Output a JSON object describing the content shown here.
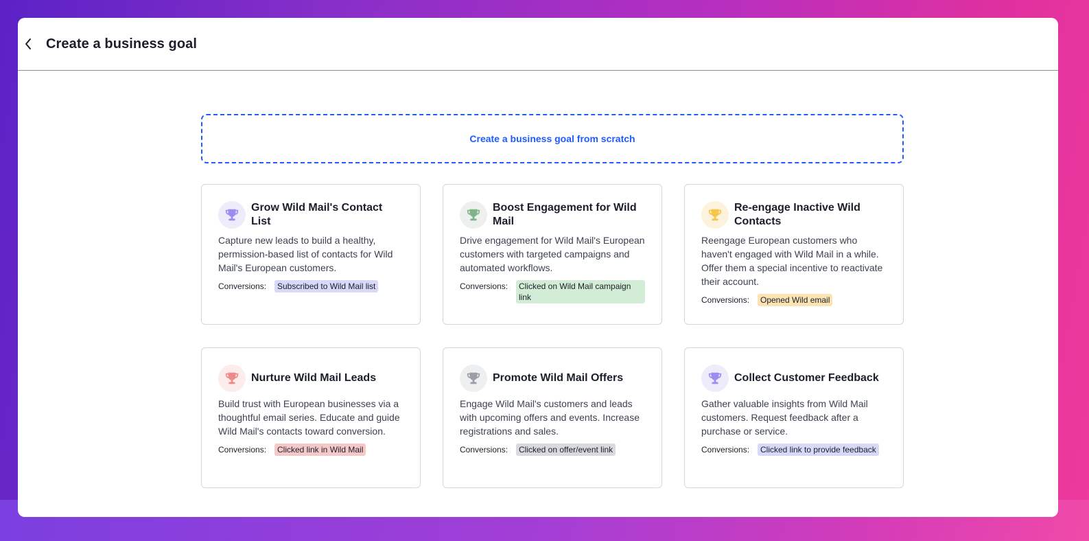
{
  "header": {
    "title": "Create a business goal"
  },
  "scratch": {
    "label": "Create a business goal from scratch"
  },
  "conversions_label": "Conversions:",
  "cards": [
    {
      "title": "Grow Wild Mail's Contact List",
      "description": "Capture new leads to build a healthy, permission-based list of contacts for Wild Mail's European customers.",
      "conversion": "Subscribed to Wild Mail list",
      "icon": "trophy-icon",
      "icon_color": "#9b8cf0",
      "icon_bg": "#eeecfb",
      "tag_color": "#d8d9f7"
    },
    {
      "title": "Boost Engagement for Wild Mail",
      "description": "Drive engagement for Wild Mail's European customers with targeted campaigns and automated workflows.",
      "conversion": "Clicked on Wild Mail campaign link",
      "icon": "trophy-icon",
      "icon_color": "#7fb38a",
      "icon_bg": "#edf0ed",
      "tag_color": "#d3ecd6"
    },
    {
      "title": "Re-engage Inactive Wild Contacts",
      "description": "Reengage European customers who haven't engaged with Wild Mail in a while. Offer them a special incentive to reactivate their account.",
      "conversion": "Opened Wild email",
      "icon": "trophy-icon",
      "icon_color": "#f5c64a",
      "icon_bg": "#fdf3dc",
      "tag_color": "#fbe3b4"
    },
    {
      "title": "Nurture Wild Mail Leads",
      "description": "Build trust with European businesses via a thoughtful email series. Educate and guide Wild Mail's contacts toward conversion.",
      "conversion": "Clicked link in Wild Mail",
      "icon": "trophy-icon",
      "icon_color": "#ef8a8a",
      "icon_bg": "#fcecec",
      "tag_color": "#f6c9c9"
    },
    {
      "title": "Promote Wild Mail Offers",
      "description": "Engage Wild Mail's customers and leads with upcoming offers and events. Increase registrations and sales.",
      "conversion": "Clicked on offer/event link",
      "icon": "trophy-icon",
      "icon_color": "#9a9ea6",
      "icon_bg": "#eeeff1",
      "tag_color": "#d9dadd"
    },
    {
      "title": "Collect Customer Feedback",
      "description": "Gather valuable insights from Wild Mail customers. Request feedback after a purchase or service.",
      "conversion": "Clicked link to provide feedback",
      "icon": "trophy-icon",
      "icon_color": "#9b8cf0",
      "icon_bg": "#eeecfb",
      "tag_color": "#d8d9f7"
    }
  ]
}
